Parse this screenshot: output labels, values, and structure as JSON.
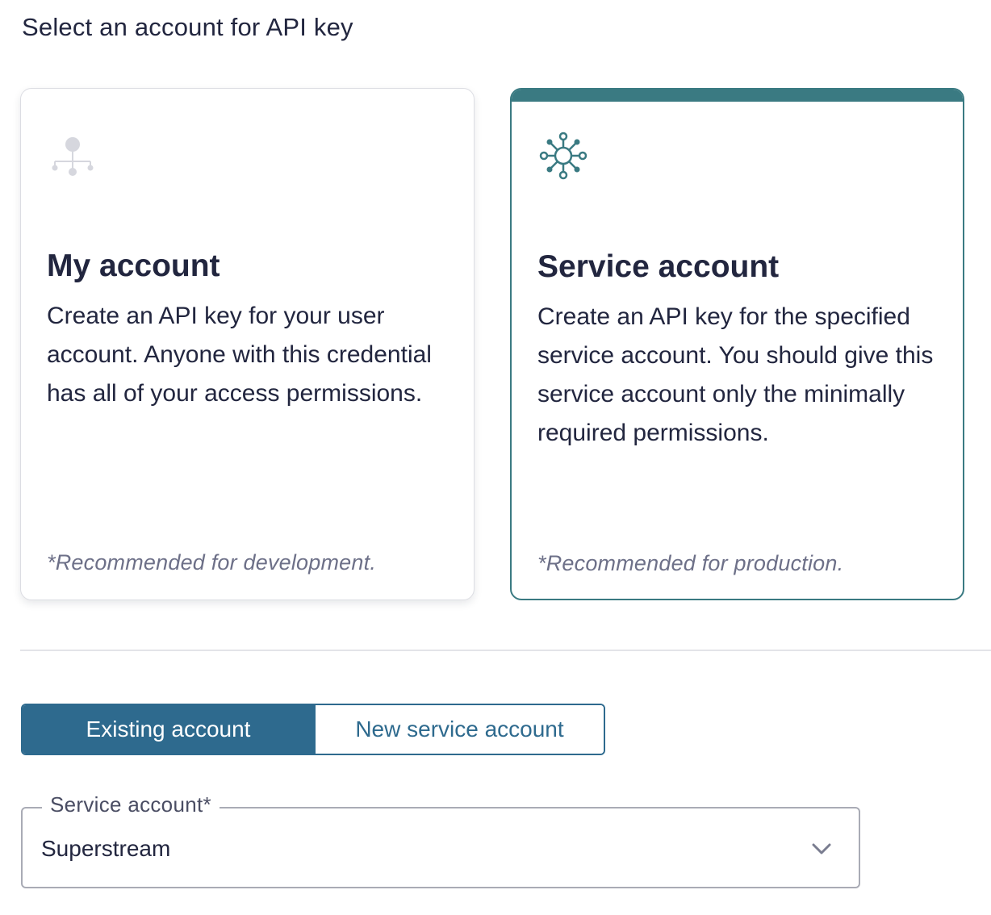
{
  "heading": "Select an account for API key",
  "cards": {
    "my_account": {
      "title": "My account",
      "description": "Create an API key for your user account. Anyone with this credential has all of your access permissions.",
      "note": "*Recommended for development.",
      "icon": "hierarchy-icon",
      "selected": false
    },
    "service_account": {
      "title": "Service account",
      "description": "Create an API key for the specified service account. You should give this service account only the minimally required permissions.",
      "note": "*Recommended for production.",
      "icon": "network-node-icon",
      "selected": true
    }
  },
  "toggle": {
    "existing_label": "Existing account",
    "new_label": "New service account",
    "active": "existing"
  },
  "service_account_field": {
    "label": "Service account*",
    "value": "Superstream"
  },
  "colors": {
    "accent_teal": "#3a7a82",
    "accent_blue": "#2e6a8e",
    "text": "#22263f",
    "muted": "#6d7088"
  }
}
